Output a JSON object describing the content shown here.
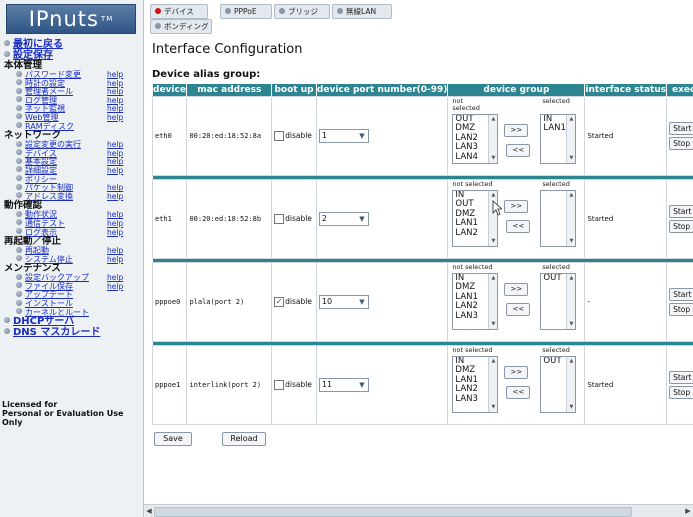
{
  "logo": {
    "text": "IPnuts",
    "tm": "TM"
  },
  "sidebar": {
    "items": [
      {
        "kind": "l1",
        "label": "最初に戻る"
      },
      {
        "kind": "l1",
        "label": "設定保存"
      },
      {
        "kind": "hdr",
        "label": "本体管理"
      },
      {
        "kind": "sub",
        "label": "パスワード変更",
        "help": "help"
      },
      {
        "kind": "sub",
        "label": "時計の設定",
        "help": "help"
      },
      {
        "kind": "sub",
        "label": "管理者メール",
        "help": "help"
      },
      {
        "kind": "sub",
        "label": "ログ管理",
        "help": "help"
      },
      {
        "kind": "sub",
        "label": "ネット監視",
        "help": "help"
      },
      {
        "kind": "sub",
        "label": "Web管理",
        "help": "help"
      },
      {
        "kind": "sub",
        "label": "RAMディスク",
        "help": ""
      },
      {
        "kind": "hdr",
        "label": "ネットワーク"
      },
      {
        "kind": "sub",
        "label": "設定変更の実行",
        "help": "help"
      },
      {
        "kind": "sub",
        "label": "デバイス",
        "help": "help"
      },
      {
        "kind": "sub",
        "label": "基本設定",
        "help": "help"
      },
      {
        "kind": "sub",
        "label": "詳細設定",
        "help": "help"
      },
      {
        "kind": "sub",
        "label": "ポリシー",
        "help": ""
      },
      {
        "kind": "sub",
        "label": "パケット制御",
        "help": "help"
      },
      {
        "kind": "sub",
        "label": "アドレス変換",
        "help": "help"
      },
      {
        "kind": "hdr",
        "label": "動作確認"
      },
      {
        "kind": "sub",
        "label": "動作状況",
        "help": "help"
      },
      {
        "kind": "sub",
        "label": "通信テスト",
        "help": "help"
      },
      {
        "kind": "sub",
        "label": "ログ表示",
        "help": "help"
      },
      {
        "kind": "hdr",
        "label": "再起動／停止"
      },
      {
        "kind": "sub",
        "label": "再起動",
        "help": "help"
      },
      {
        "kind": "sub",
        "label": "システム停止",
        "help": "help"
      },
      {
        "kind": "hdr",
        "label": "メンテナンス"
      },
      {
        "kind": "sub",
        "label": "設定バックアップ",
        "help": "help"
      },
      {
        "kind": "sub",
        "label": "ファイル保存",
        "help": "help"
      },
      {
        "kind": "sub",
        "label": "アップデート",
        "help": ""
      },
      {
        "kind": "sub",
        "label": "インストール",
        "help": ""
      },
      {
        "kind": "sub",
        "label": "カーネルとルート",
        "help": ""
      },
      {
        "kind": "l1",
        "label": "DHCPサーバ"
      },
      {
        "kind": "l1",
        "label": "DNS マスカレード"
      }
    ],
    "license_line1": "Licensed for",
    "license_line2": "Personal or Evaluation Use",
    "license_line3": "Only"
  },
  "tabs": [
    {
      "label": "デバイス",
      "active": true
    },
    {
      "label": "PPPoE",
      "active": false
    },
    {
      "label": "ブリッジ",
      "active": false
    },
    {
      "label": "無線LAN",
      "active": false
    },
    {
      "label": "ボンディング",
      "active": false
    }
  ],
  "page_title": "Interface Configuration",
  "group_label": "Device alias group:",
  "table": {
    "headers": [
      "device",
      "mac address",
      "boot up",
      "device port number(0-99)",
      "device group",
      "interface status",
      "execut"
    ],
    "disable_label": "disable",
    "not_selected_label": "not selected",
    "not_selected_label_wrapped": "not\nselected",
    "selected_label": "selected",
    "move_right": ">>",
    "move_left": "<<",
    "start_label": "Start",
    "stop_label": "Stop",
    "rows": [
      {
        "device": "eth0",
        "mac": "00:20:ed:18:52:8a",
        "disabled": false,
        "port": "1",
        "not_selected": [
          "OUT",
          "DMZ",
          "LAN2",
          "LAN3",
          "LAN4"
        ],
        "selected": [
          "IN",
          "LAN1"
        ],
        "status": "Started"
      },
      {
        "device": "eth1",
        "mac": "00:20:ed:18:52:8b",
        "disabled": false,
        "port": "2",
        "not_selected": [
          "IN",
          "OUT",
          "DMZ",
          "LAN1",
          "LAN2"
        ],
        "selected": [],
        "status": "Started"
      },
      {
        "device": "pppoe0",
        "mac": "plala(port 2)",
        "disabled": true,
        "port": "10",
        "not_selected": [
          "IN",
          "DMZ",
          "LAN1",
          "LAN2",
          "LAN3"
        ],
        "selected": [
          "OUT"
        ],
        "status": "-"
      },
      {
        "device": "pppoe1",
        "mac": "interlink(port 2)",
        "disabled": false,
        "port": "11",
        "not_selected": [
          "IN",
          "DMZ",
          "LAN1",
          "LAN2",
          "LAN3"
        ],
        "selected": [
          "OUT"
        ],
        "status": "Started"
      }
    ]
  },
  "buttons": {
    "save": "Save",
    "reload": "Reload"
  },
  "colors": {
    "header_teal": "#2d8591",
    "link_blue": "#1a2dbf",
    "active_dot": "#d01010"
  }
}
